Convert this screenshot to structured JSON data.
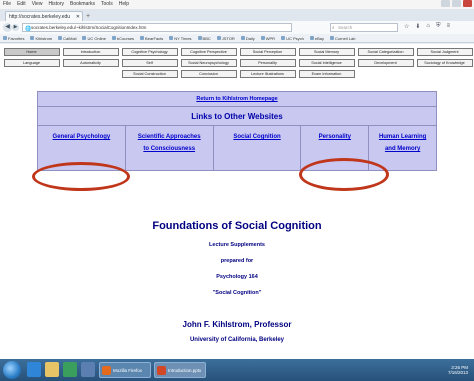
{
  "browser": {
    "menu": [
      "File",
      "Edit",
      "View",
      "History",
      "Bookmarks",
      "Tools",
      "Help"
    ],
    "tab_title": "http://socrates.berkeley.edu",
    "url": "socrates.berkeley.edu/~kihlstrm/SocialCognitionIndex.htm",
    "search_placeholder": "Search",
    "bookmarks": [
      "Favorites",
      "Kihlstrom",
      "CalMail",
      "UC Online",
      "bCourses",
      "BearFacts",
      "NY Times",
      "BBC",
      "JSTOR",
      "Daily",
      "WPR",
      "UC Psych",
      "eBay",
      "Cornell Lab"
    ]
  },
  "nav_buttons": [
    [
      "Home",
      "Introduction",
      "Cognitive Psychology",
      "Cognitive Perspective",
      "Social Perception",
      "Social Memory",
      "Social Categorization",
      "Social Judgment"
    ],
    [
      "Language",
      "Automaticity",
      "Self",
      "Social Neuropsychology",
      "Personality",
      "Social Intelligence",
      "Development",
      "Sociology of Knowledge"
    ],
    [
      "Social Construction",
      "Conclusion",
      "Lecture Illustrations",
      "Exam Information"
    ]
  ],
  "links": {
    "return": "Return to Kihlstrom Homepage",
    "heading": "Links to Other Websites",
    "items": [
      {
        "lines": [
          "General Psychology"
        ]
      },
      {
        "lines": [
          "Scientific Approaches",
          "to Consciousness"
        ]
      },
      {
        "lines": [
          "Social Cognition"
        ]
      },
      {
        "lines": [
          "Personality"
        ]
      },
      {
        "lines": [
          "Human Learning",
          "and Memory"
        ]
      }
    ]
  },
  "page": {
    "title": "Foundations of Social Cognition",
    "lines": [
      "Lecture Supplements",
      "prepared for",
      "Psychology 164",
      "\"Social Cognition\""
    ],
    "author": "John F. Kihlstrom, Professor",
    "affiliation": "University of California, Berkeley"
  },
  "taskbar": {
    "tasks": [
      "Mozilla Firefox",
      "Introduction.pptx"
    ],
    "time": "3:26 PM",
    "date": "7/16/2013"
  },
  "colors": {
    "accent_text": "#000080",
    "link": "#0000cc",
    "links_bg": "#c8c8f0",
    "annotation": "#c0361a"
  }
}
